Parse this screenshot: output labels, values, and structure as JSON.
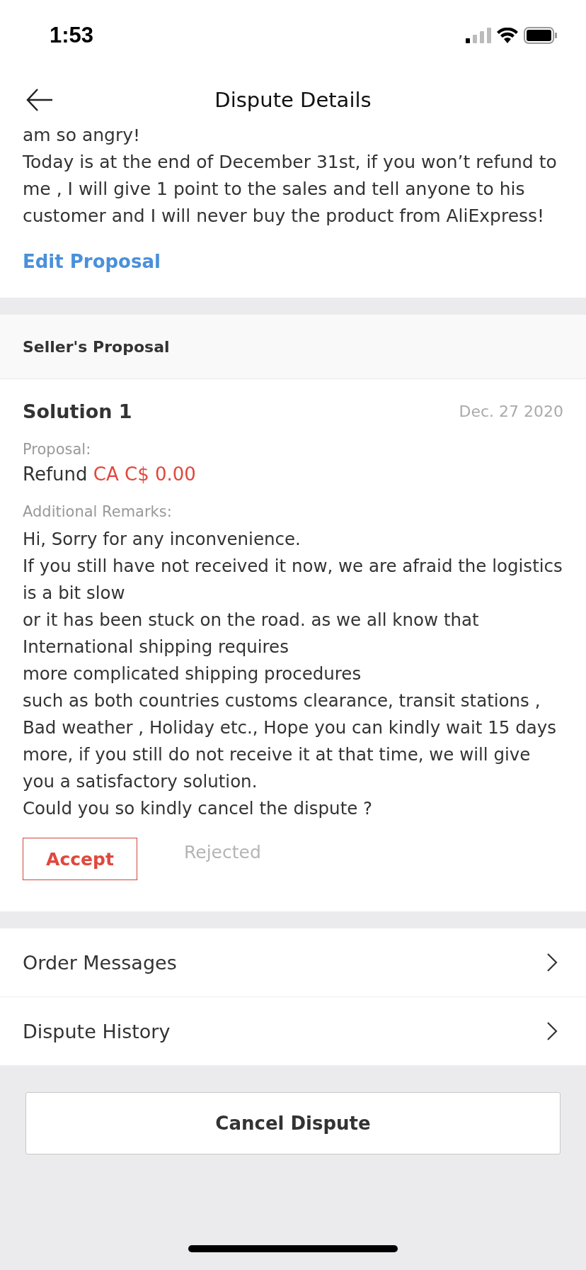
{
  "status_bar": {
    "time": "1:53"
  },
  "nav": {
    "title": "Dispute Details"
  },
  "message": {
    "text": "am so angry!\nToday is at the end of December 31st, if you won’t refund to me , I will give 1 point to the sales and tell anyone to his customer and I will never buy the product from AliExpress!",
    "link": "Edit Proposal"
  },
  "seller_proposal": {
    "heading": "Seller's Proposal",
    "solution": {
      "title": "Solution 1",
      "date": "Dec. 27 2020",
      "proposal_label": "Proposal:",
      "proposal_text": "Refund",
      "amount": "CA C$ 0.00",
      "remarks_label": "Additional Remarks:",
      "remarks": "Hi, Sorry for any inconvenience.\nIf you still have not received it now, we are afraid the logistics is a bit slow\nor it has been stuck on the road. as we all know that International shipping requires\nmore complicated shipping procedures\nsuch as both countries customs clearance, transit stations , Bad weather , Holiday etc., Hope you can kindly wait 15 days more, if you still do not receive it at that time, we will give you a satisfactory solution.\nCould you so kindly cancel the dispute ?",
      "actions": [
        {
          "kind": "button",
          "label": "Accept"
        },
        {
          "kind": "status",
          "label": "Rejected"
        }
      ]
    }
  },
  "links": [
    {
      "label": "Order Messages"
    },
    {
      "label": "Dispute History"
    }
  ],
  "footer": {
    "button": "Cancel Dispute"
  }
}
